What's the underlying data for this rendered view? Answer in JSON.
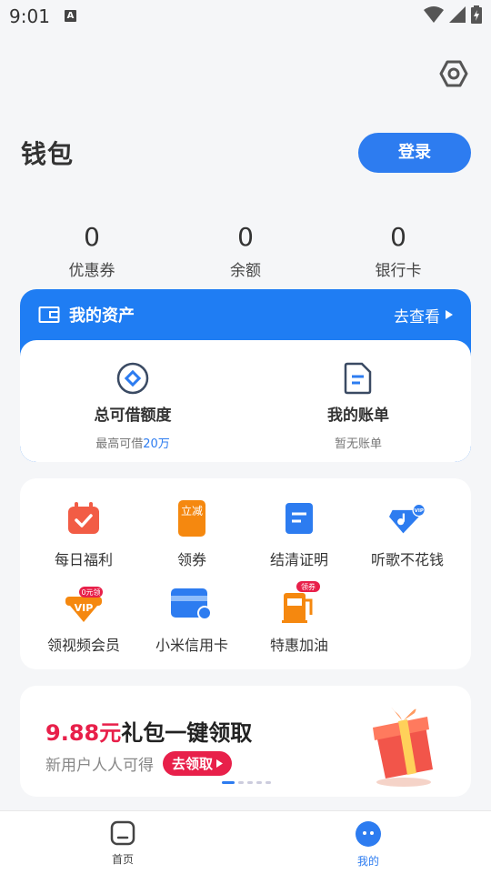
{
  "status": {
    "time": "9:01",
    "a_badge": "A"
  },
  "header": {
    "title": "钱包",
    "login_label": "登录"
  },
  "stats": [
    {
      "value": "0",
      "label": "优惠券"
    },
    {
      "value": "0",
      "label": "余额"
    },
    {
      "value": "0",
      "label": "银行卡"
    }
  ],
  "assets": {
    "title": "我的资产",
    "link": "去查看",
    "items": [
      {
        "title": "总可借额度",
        "sub_prefix": "最高可借",
        "sub_highlight": "20万"
      },
      {
        "title": "我的账单",
        "sub": "暂无账单"
      }
    ]
  },
  "services": [
    {
      "label": "每日福利",
      "icon": "calendar-check-icon"
    },
    {
      "label": "领券",
      "icon": "coupon-icon",
      "icon_text": "立减"
    },
    {
      "label": "结清证明",
      "icon": "document-icon"
    },
    {
      "label": "听歌不花钱",
      "icon": "music-vip-icon",
      "icon_text": "VIP"
    },
    {
      "label": "领视频会员",
      "icon": "video-vip-icon",
      "icon_text": "VIP",
      "badge": "0元领"
    },
    {
      "label": "小米信用卡",
      "icon": "credit-card-icon"
    },
    {
      "label": "特惠加油",
      "icon": "fuel-pump-icon",
      "badge": "领券"
    }
  ],
  "banner": {
    "price": "9.88元",
    "title_rest": "礼包一键领取",
    "sub": "新用户人人可得",
    "button": "去领取"
  },
  "tabs": [
    {
      "label": "首页",
      "active": false
    },
    {
      "label": "我的",
      "active": true
    }
  ],
  "colors": {
    "accent": "#2d7cf0",
    "promo": "#e8204a",
    "background": "#f5f6f8"
  }
}
